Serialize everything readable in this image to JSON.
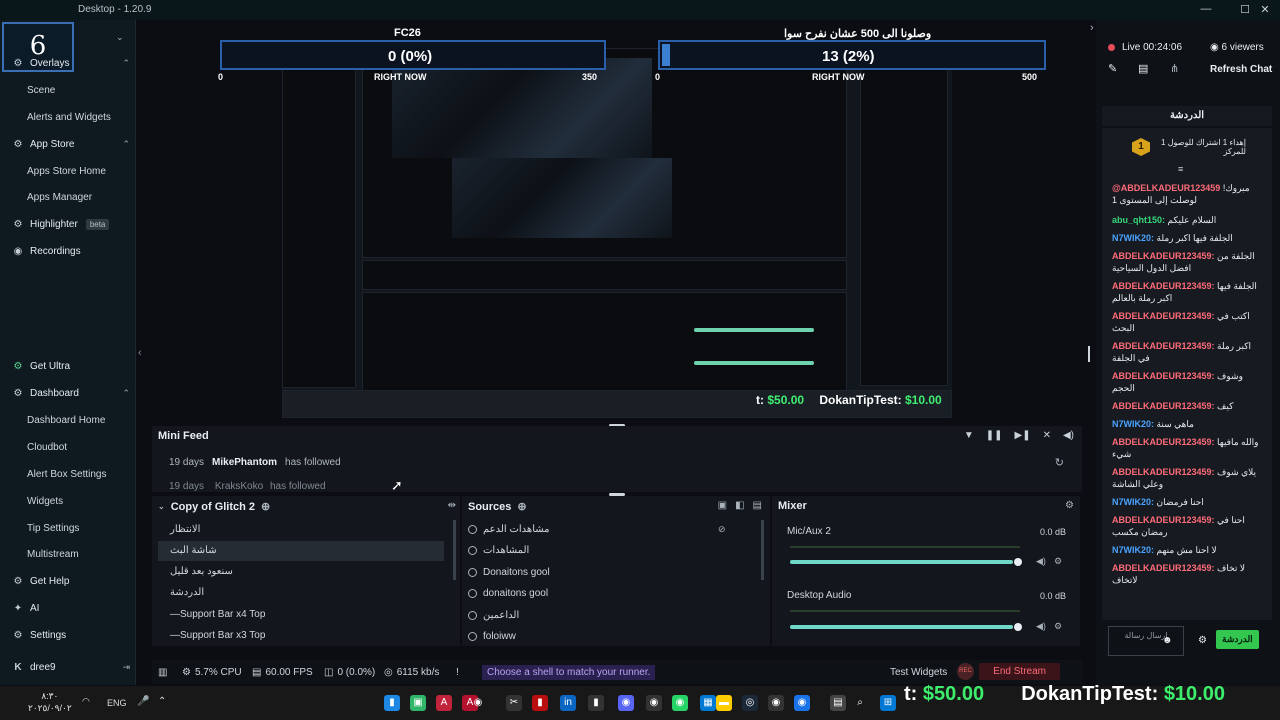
{
  "window": {
    "title": "Desktop - 1.20.9"
  },
  "logo": {
    "text": "6"
  },
  "sidebar": {
    "sections": [
      {
        "label": "Overlays",
        "icon": "gear-icon"
      },
      {
        "label": "App Store",
        "icon": "gear-icon"
      },
      {
        "label": "Highlighter",
        "icon": "gear-icon",
        "badge": "beta"
      },
      {
        "label": "Recordings",
        "icon": "record-icon"
      },
      {
        "label": "Get Ultra",
        "icon": "ultra-icon"
      },
      {
        "label": "Dashboard",
        "icon": "gear-icon"
      },
      {
        "label": "Get Help",
        "icon": "help-icon"
      },
      {
        "label": "AI",
        "icon": "ai-icon"
      },
      {
        "label": "Settings",
        "icon": "gear-icon"
      }
    ],
    "overlay_items": [
      "Scene",
      "Alerts and Widgets"
    ],
    "appstore_items": [
      "Apps Store Home",
      "Apps Manager"
    ],
    "dashboard_items": [
      "Dashboard Home",
      "Cloudbot",
      "Alert Box Settings",
      "Widgets",
      "Tip Settings",
      "Multistream"
    ],
    "user": {
      "name": "dree9",
      "badge": "K"
    }
  },
  "overlay": {
    "left": {
      "title": "FC26",
      "value": "0 (0%)",
      "min": "0",
      "max": "350",
      "label": "RIGHT NOW"
    },
    "right": {
      "title": "وصلونا الى 500 عشان نفرح سوا",
      "value": "13 (2%)",
      "min": "0",
      "max": "500",
      "label": "RIGHT NOW"
    }
  },
  "donation_small": {
    "prefix": "t:",
    "amount": "$50.00",
    "name": "DokanTipTest:",
    "tip": "$10.00"
  },
  "minifeed": {
    "title": "Mini Feed",
    "rows": [
      {
        "time": "19 days",
        "user": "MikePhantom",
        "action": "has followed"
      },
      {
        "time": "19 days",
        "user": "KraksKoko",
        "action": "has followed"
      }
    ]
  },
  "scenes": {
    "title": "Copy of Glitch 2",
    "items": [
      "الانتظار",
      "شاشة البث",
      "سنعود بعد قليل",
      "الدردشة",
      "—Support Bar x4 Top",
      "—Support Bar x3 Top"
    ],
    "active_index": 1
  },
  "sources": {
    "title": "Sources",
    "items": [
      "مشاهدات الدعم",
      "المشاهدات",
      "Donaitons gool",
      "donaitons gool",
      "الداعمين",
      "foloiww"
    ]
  },
  "mixer": {
    "title": "Mixer",
    "channels": [
      {
        "name": "Mic/Aux 2",
        "db": "0.0 dB",
        "level": 0.97
      },
      {
        "name": "Desktop Audio",
        "db": "0.0 dB",
        "level": 0.97
      }
    ]
  },
  "status": {
    "cpu": "5.7% CPU",
    "fps": "60.00 FPS",
    "dropped": "0 (0.0%)",
    "bitrate": "6115 kb/s",
    "shell_msg": "Choose a shell to match your runner.",
    "test_widgets": "Test Widgets",
    "rec": "REC",
    "end_stream": "End Stream"
  },
  "chat": {
    "live": "Live 00:24:06",
    "viewers": "6 viewers",
    "refresh": "Refresh Chat",
    "tab": "الدردشة",
    "pinned": {
      "rank": "1",
      "text": "إهداء 1 اشتراك للوصول 1 للمركز"
    },
    "messages": [
      {
        "name": "@ABDELKADEUR123459",
        "color": "red",
        "text": "مبروك! لوصلت إلى المستوى 1"
      },
      {
        "name": "abu_qht150:",
        "color": "green",
        "text": "السلام عليكم"
      },
      {
        "name": "N7WIK20:",
        "color": "blue",
        "text": "الجلفة فيها اكبر رملة"
      },
      {
        "name": "ABDELKADEUR123459:",
        "color": "red",
        "text": "الجلفة من افضل الدول السياحية"
      },
      {
        "name": "ABDELKADEUR123459:",
        "color": "red",
        "text": "الجلفة فيها اكبر رملة بالعالم"
      },
      {
        "name": "ABDELKADEUR123459:",
        "color": "red",
        "text": "اكتب في البحث"
      },
      {
        "name": "ABDELKADEUR123459:",
        "color": "red",
        "text": "اكبر رملة في الجلفة"
      },
      {
        "name": "ABDELKADEUR123459:",
        "color": "red",
        "text": "وشوف الحجم"
      },
      {
        "name": "ABDELKADEUR123459:",
        "color": "red",
        "text": "كيف"
      },
      {
        "name": "N7WIK20:",
        "color": "blue",
        "text": "ماهي سنة"
      },
      {
        "name": "ABDELKADEUR123459:",
        "color": "red",
        "text": "والله مافيها شيء"
      },
      {
        "name": "ABDELKADEUR123459:",
        "color": "red",
        "text": "يلاي شوف وعلي الشاشة"
      },
      {
        "name": "N7WIK20:",
        "color": "blue",
        "text": "احنا فرمضان"
      },
      {
        "name": "ABDELKADEUR123459:",
        "color": "red",
        "text": "احنا في رمضان مكسب"
      },
      {
        "name": "N7WIK20:",
        "color": "blue",
        "text": "لا احنا مش منهم"
      },
      {
        "name": "ABDELKADEUR123459:",
        "color": "red",
        "text": "لا تخاف لاتخاف"
      }
    ],
    "input_placeholder": "إرسال رسالة",
    "send": "الدردشة"
  },
  "taskbar": {
    "time": "٨:٣٠",
    "date": "٢٠٢٥/٠٩/٠٢",
    "lang": "ENG"
  },
  "big_donation": {
    "prefix": "t:",
    "amount": "$50.00",
    "name": "DokanTipTest:",
    "tip": "$10.00"
  },
  "colors": {
    "accent_green": "#37d57a",
    "accent_blue": "#2a5fa9",
    "end_stream": "#ff6b78",
    "fader": "#6fd8c8"
  }
}
